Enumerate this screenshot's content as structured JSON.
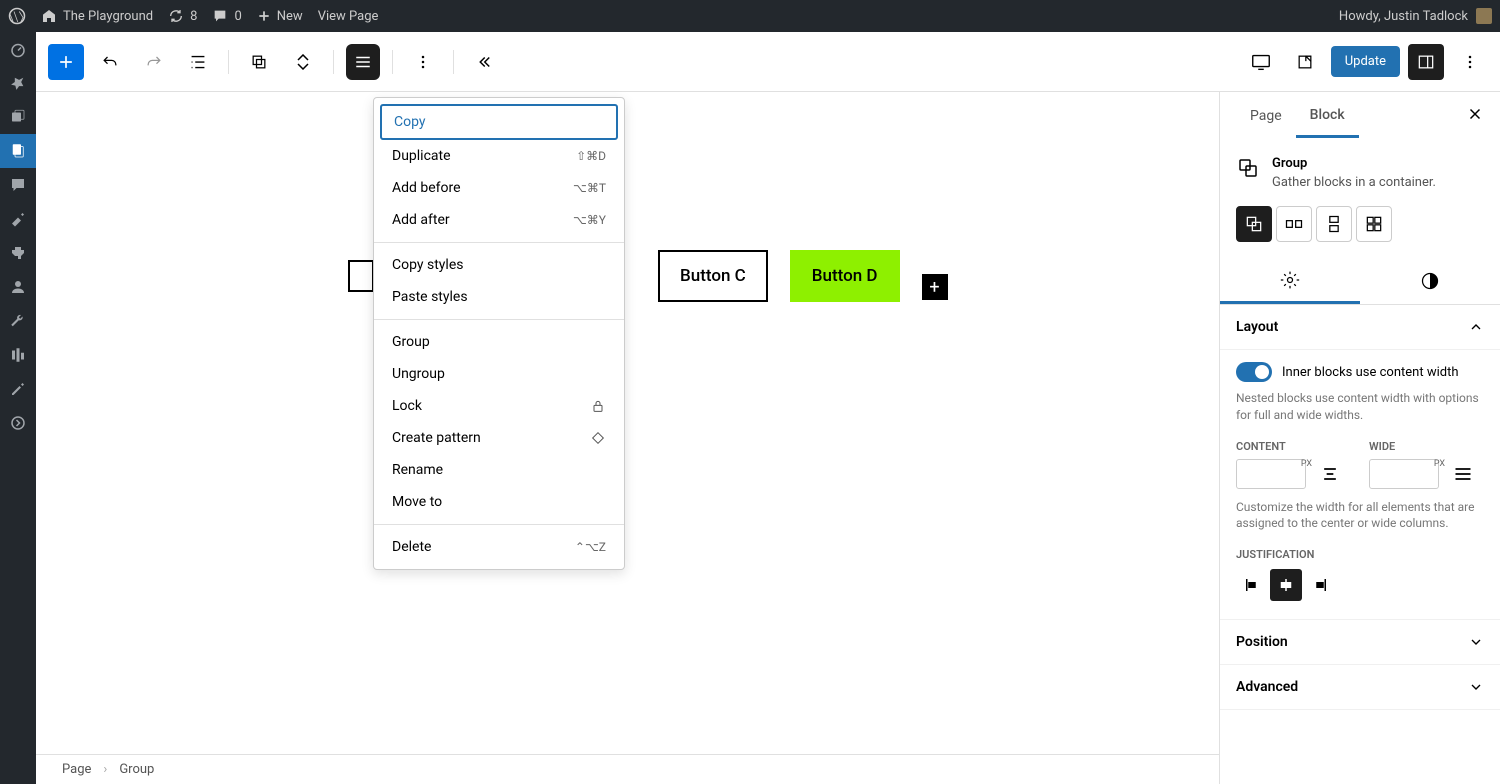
{
  "adminBar": {
    "siteTitle": "The Playground",
    "updateCount": "8",
    "commentCount": "0",
    "newLabel": "New",
    "viewPageLabel": "View Page",
    "howdy": "Howdy, Justin Tadlock"
  },
  "toolbar": {
    "updateLabel": "Update"
  },
  "canvas": {
    "buttonC": "Button C",
    "buttonD": "Button D"
  },
  "contextMenu": {
    "copy": "Copy",
    "duplicate": "Duplicate",
    "duplicateShortcut": "⇧⌘D",
    "addBefore": "Add before",
    "addBeforeShortcut": "⌥⌘T",
    "addAfter": "Add after",
    "addAfterShortcut": "⌥⌘Y",
    "copyStyles": "Copy styles",
    "pasteStyles": "Paste styles",
    "group": "Group",
    "ungroup": "Ungroup",
    "lock": "Lock",
    "createPattern": "Create pattern",
    "rename": "Rename",
    "moveTo": "Move to",
    "delete": "Delete",
    "deleteShortcut": "⌃⌥Z"
  },
  "sidebar": {
    "pageTab": "Page",
    "blockTab": "Block",
    "blockName": "Group",
    "blockDesc": "Gather blocks in a container.",
    "layoutLabel": "Layout",
    "toggleLabel": "Inner blocks use content width",
    "toggleHelp": "Nested blocks use content width with options for full and wide widths.",
    "contentLabel": "CONTENT",
    "wideLabel": "WIDE",
    "widthHelp": "Customize the width for all elements that are assigned to the center or wide columns.",
    "justificationLabel": "JUSTIFICATION",
    "positionLabel": "Position",
    "advancedLabel": "Advanced",
    "px": "PX"
  },
  "breadcrumb": {
    "page": "Page",
    "group": "Group"
  }
}
